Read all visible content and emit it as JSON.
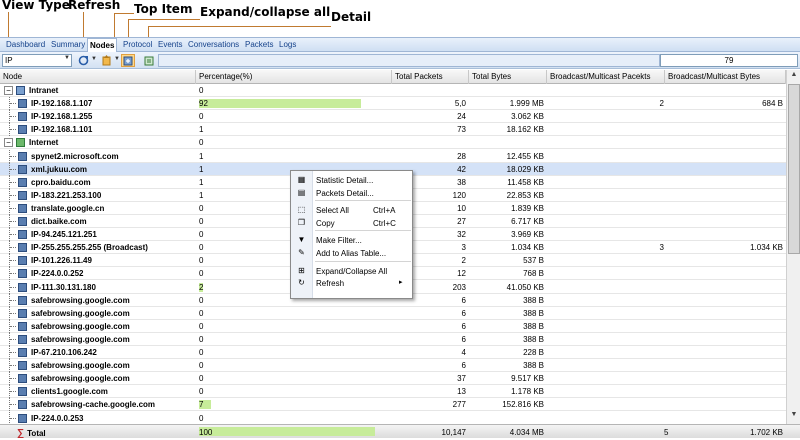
{
  "callouts": {
    "view_type": "View Type",
    "refresh": "Refresh",
    "top_item": "Top Item",
    "expand_collapse": "Expand/collapse all",
    "detail": "Detail"
  },
  "tabs": [
    "Dashboard",
    "Summary",
    "Nodes",
    "Protocol",
    "Events",
    "Conversations",
    "Packets",
    "Logs"
  ],
  "active_tab": "Nodes",
  "toolbar": {
    "view_type_value": "IP",
    "node_count": "79"
  },
  "columns": [
    "Node",
    "Percentage(%)",
    "Total Packets",
    "Total Bytes",
    "Broadcast/Multicast Pacekts",
    "Broadcast/Multicast Bytes"
  ],
  "rows": [
    {
      "node": "Intranet",
      "pct": "0",
      "packets": "",
      "bytes": "",
      "bpk": "",
      "bby": "",
      "group": true,
      "icon": "intranet"
    },
    {
      "node": "IP-192.168.1.107",
      "pct": "92",
      "packets": "5,0",
      "bytes": "1.999 MB",
      "bpk": "2",
      "bby": "684 B",
      "bar": 0.92
    },
    {
      "node": "IP-192.168.1.255",
      "pct": "0",
      "packets": "24",
      "bytes": "3.062 KB",
      "bpk": "",
      "bby": ""
    },
    {
      "node": "IP-192.168.1.101",
      "pct": "1",
      "packets": "73",
      "bytes": "18.162 KB",
      "bpk": "",
      "bby": ""
    },
    {
      "node": "Internet",
      "pct": "0",
      "packets": "",
      "bytes": "",
      "bpk": "",
      "bby": "",
      "group": true,
      "icon": "internet"
    },
    {
      "node": "spynet2.microsoft.com",
      "pct": "1",
      "packets": "28",
      "bytes": "12.455 KB",
      "bpk": "",
      "bby": ""
    },
    {
      "node": "xml.jukuu.com",
      "pct": "1",
      "packets": "42",
      "bytes": "18.029 KB",
      "bpk": "",
      "bby": "",
      "selected": true
    },
    {
      "node": "cpro.baidu.com",
      "pct": "1",
      "packets": "38",
      "bytes": "11.458 KB",
      "bpk": "",
      "bby": ""
    },
    {
      "node": "IP-183.221.253.100",
      "pct": "1",
      "packets": "120",
      "bytes": "22.853 KB",
      "bpk": "",
      "bby": ""
    },
    {
      "node": "translate.google.cn",
      "pct": "0",
      "packets": "10",
      "bytes": "1.839 KB",
      "bpk": "",
      "bby": ""
    },
    {
      "node": "dict.baike.com",
      "pct": "0",
      "packets": "27",
      "bytes": "6.717 KB",
      "bpk": "",
      "bby": ""
    },
    {
      "node": "IP-94.245.121.251",
      "pct": "0",
      "packets": "32",
      "bytes": "3.969 KB",
      "bpk": "",
      "bby": ""
    },
    {
      "node": "IP-255.255.255.255 (Broadcast)",
      "pct": "0",
      "packets": "3",
      "bytes": "1.034 KB",
      "bpk": "3",
      "bby": "1.034 KB"
    },
    {
      "node": "IP-101.226.11.49",
      "pct": "0",
      "packets": "2",
      "bytes": "537 B",
      "bpk": "",
      "bby": ""
    },
    {
      "node": "IP-224.0.0.252",
      "pct": "0",
      "packets": "12",
      "bytes": "768 B",
      "bpk": "",
      "bby": ""
    },
    {
      "node": "IP-111.30.131.180",
      "pct": "2",
      "packets": "203",
      "bytes": "41.050 KB",
      "bpk": "",
      "bby": "",
      "bar": 0.02
    },
    {
      "node": "safebrowsing.google.com",
      "pct": "0",
      "packets": "6",
      "bytes": "388 B",
      "bpk": "",
      "bby": ""
    },
    {
      "node": "safebrowsing.google.com",
      "pct": "0",
      "packets": "6",
      "bytes": "388 B",
      "bpk": "",
      "bby": ""
    },
    {
      "node": "safebrowsing.google.com",
      "pct": "0",
      "packets": "6",
      "bytes": "388 B",
      "bpk": "",
      "bby": ""
    },
    {
      "node": "safebrowsing.google.com",
      "pct": "0",
      "packets": "6",
      "bytes": "388 B",
      "bpk": "",
      "bby": ""
    },
    {
      "node": "IP-67.210.106.242",
      "pct": "0",
      "packets": "4",
      "bytes": "228 B",
      "bpk": "",
      "bby": ""
    },
    {
      "node": "safebrowsing.google.com",
      "pct": "0",
      "packets": "6",
      "bytes": "388 B",
      "bpk": "",
      "bby": ""
    },
    {
      "node": "safebrowsing.google.com",
      "pct": "0",
      "packets": "37",
      "bytes": "9.517 KB",
      "bpk": "",
      "bby": ""
    },
    {
      "node": "clients1.google.com",
      "pct": "0",
      "packets": "13",
      "bytes": "1.178 KB",
      "bpk": "",
      "bby": ""
    },
    {
      "node": "safebrowsing-cache.google.com",
      "pct": "7",
      "packets": "277",
      "bytes": "152.816 KB",
      "bpk": "",
      "bby": "",
      "bar": 0.07
    },
    {
      "node": "IP-224.0.0.253",
      "pct": "0",
      "packets": "",
      "bytes": "",
      "bpk": "",
      "bby": ""
    }
  ],
  "total": {
    "label": "Total",
    "pct": "100",
    "packets": "10,147",
    "bytes": "4.034 MB",
    "bpk": "5",
    "bby": "1.702 KB",
    "bar": 1.0
  },
  "context_menu": [
    {
      "label": "Statistic Detail...",
      "shortcut": "",
      "icon": "statistic-icon"
    },
    {
      "label": "Packets Detail...",
      "shortcut": "",
      "icon": "packets-icon"
    },
    {
      "sep": true
    },
    {
      "label": "Select All",
      "shortcut": "Ctrl+A",
      "icon": "select-all-icon"
    },
    {
      "label": "Copy",
      "shortcut": "Ctrl+C",
      "icon": "copy-icon"
    },
    {
      "sep": true
    },
    {
      "label": "Make Filter...",
      "shortcut": "",
      "icon": "filter-icon"
    },
    {
      "label": "Add to Alias Table...",
      "shortcut": "",
      "icon": "alias-icon"
    },
    {
      "sep": true
    },
    {
      "label": "Expand/Collapse All",
      "shortcut": "",
      "icon": "expand-collapse-icon"
    },
    {
      "label": "Refresh",
      "shortcut": "",
      "icon": "refresh-icon",
      "submenu": true
    }
  ],
  "colors": {
    "bar": "#c7ec9a",
    "selection": "#d4e2f7",
    "tab_text": "#15428b",
    "callout_line": "#c07a30"
  }
}
